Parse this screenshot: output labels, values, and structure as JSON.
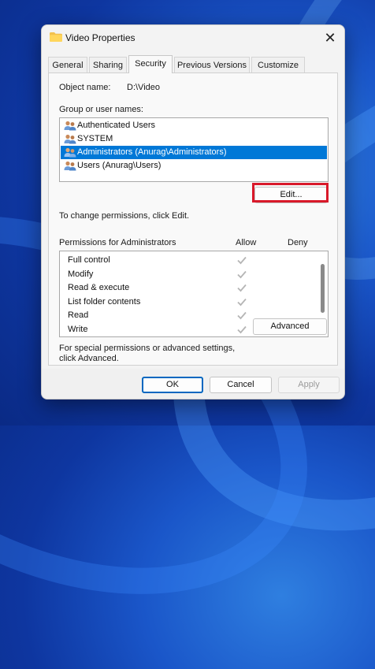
{
  "window": {
    "title": "Video Properties",
    "close_glyph": "✕",
    "icon": "folder-icon"
  },
  "tabs": [
    {
      "label": "General"
    },
    {
      "label": "Sharing"
    },
    {
      "label": "Security",
      "active": true
    },
    {
      "label": "Previous Versions"
    },
    {
      "label": "Customize"
    }
  ],
  "security": {
    "object_name_label": "Object name:",
    "object_name_value": "D:\\Video",
    "group_label": "Group or user names:",
    "users": [
      {
        "name": "Authenticated Users",
        "selected": false
      },
      {
        "name": "SYSTEM",
        "selected": false
      },
      {
        "name": "Administrators (Anurag\\Administrators)",
        "selected": true
      },
      {
        "name": "Users (Anurag\\Users)",
        "selected": false
      }
    ],
    "change_text": "To change permissions, click Edit.",
    "edit_button": "Edit...",
    "permissions_label": "Permissions for Administrators",
    "allow_header": "Allow",
    "deny_header": "Deny",
    "permissions": [
      {
        "name": "Full control",
        "allow": true,
        "deny": false
      },
      {
        "name": "Modify",
        "allow": true,
        "deny": false
      },
      {
        "name": "Read & execute",
        "allow": true,
        "deny": false
      },
      {
        "name": "List folder contents",
        "allow": true,
        "deny": false
      },
      {
        "name": "Read",
        "allow": true,
        "deny": false
      },
      {
        "name": "Write",
        "allow": true,
        "deny": false
      }
    ],
    "advanced_text_line1": "For special permissions or advanced settings,",
    "advanced_text_line2": "click Advanced.",
    "advanced_button": "Advanced"
  },
  "footer": {
    "ok": "OK",
    "cancel": "Cancel",
    "apply": "Apply"
  },
  "colors": {
    "selection": "#0078d7",
    "highlight_box": "#d9192a",
    "ok_border": "#0067c0"
  }
}
